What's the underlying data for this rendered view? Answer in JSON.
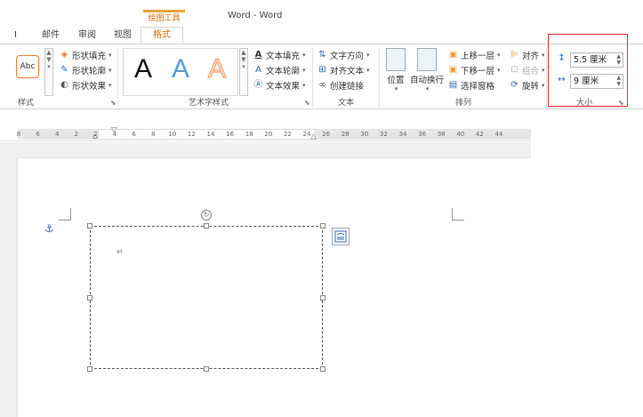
{
  "titlebar": {
    "drawing_tools": "绘图工具",
    "window_title": "Word - Word"
  },
  "tabs": {
    "partial_left": "I",
    "mailings": "邮件",
    "review": "审阅",
    "view": "视图",
    "format": "格式"
  },
  "ribbon": {
    "shape_styles": {
      "sample_text": "Abc",
      "shape_fill": "形状填充",
      "shape_outline": "形状轮廓",
      "shape_effects": "形状效果",
      "group_label": "样式"
    },
    "wordart": {
      "letters": [
        "A",
        "A",
        "A"
      ],
      "text_fill": "文本填充",
      "text_outline": "文本轮廓",
      "text_effects": "文本效果",
      "group_label": "艺术字样式"
    },
    "text": {
      "text_direction": "文字方向",
      "align_text": "对齐文本",
      "create_link": "创建链接",
      "group_label": "文本"
    },
    "arrange": {
      "position": "位置",
      "wrap_text": "自动换行",
      "bring_forward": "上移一层",
      "send_backward": "下移一层",
      "selection_pane": "选择窗格",
      "align": "对齐",
      "group": "组合",
      "rotate": "旋转",
      "group_label": "排列"
    },
    "size": {
      "height_value": "5.5 厘米",
      "width_value": "9 厘米",
      "group_label": "大小"
    }
  },
  "ruler": {
    "ticks": [
      "8",
      "6",
      "4",
      "2",
      "2",
      "4",
      "6",
      "8",
      "10",
      "12",
      "14",
      "16",
      "18",
      "20",
      "22",
      "24",
      "26",
      "28",
      "30",
      "32",
      "34",
      "36",
      "38",
      "40",
      "42",
      "44"
    ]
  },
  "document": {
    "cursor_mark": "↵"
  },
  "colors": {
    "accent": "#d0700f",
    "tab_highlight": "#e8a33c",
    "annotation_red": "#e03030",
    "wordart_blue": "#5b9bd5",
    "wordart_orange": "#f4b183"
  }
}
